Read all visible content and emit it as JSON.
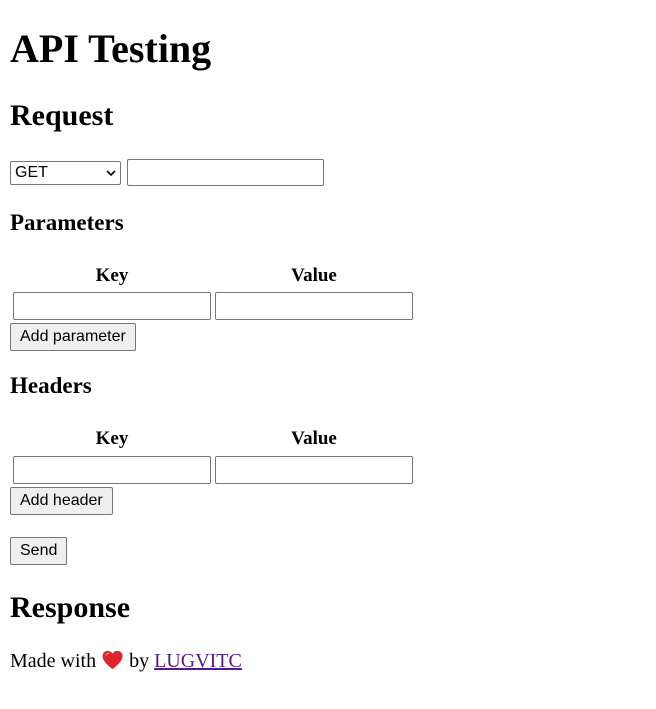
{
  "page": {
    "title": "API Testing"
  },
  "request": {
    "title": "Request",
    "method": {
      "selected": "GET"
    },
    "url": {
      "value": "",
      "placeholder": ""
    },
    "send_label": "Send"
  },
  "parameters": {
    "title": "Parameters",
    "columns": [
      "Key",
      "Value"
    ],
    "rows": [
      {
        "key": "",
        "value": ""
      }
    ],
    "add_label": "Add parameter"
  },
  "headers": {
    "title": "Headers",
    "columns": [
      "Key",
      "Value"
    ],
    "rows": [
      {
        "key": "",
        "value": ""
      }
    ],
    "add_label": "Add header"
  },
  "response": {
    "title": "Response"
  },
  "footer": {
    "prefix": "Made with",
    "icon": "heart-icon",
    "by": "by",
    "link_text": "LUGVITC",
    "heart_color": "#e0242c",
    "link_color": "#551a8b"
  }
}
